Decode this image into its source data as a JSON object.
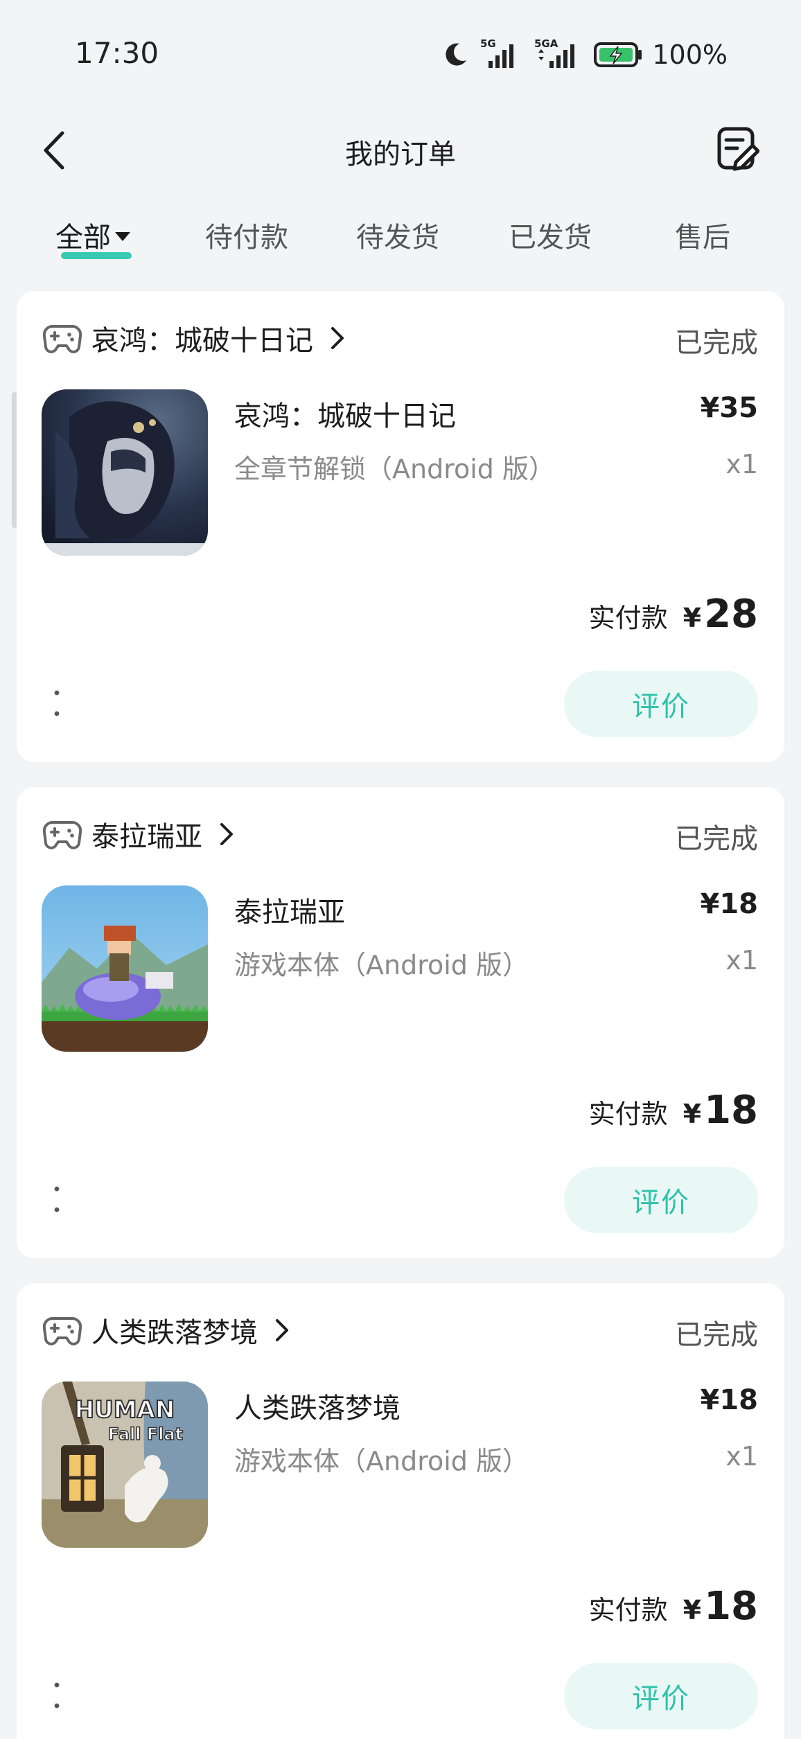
{
  "status_bar": {
    "time": "17:30",
    "battery_percent": "100%",
    "signal_1": "5G",
    "signal_2": "5GA",
    "icons": [
      "moon-icon",
      "signal-5g-icon",
      "signal-5ga-icon",
      "battery-charging-icon"
    ]
  },
  "nav": {
    "title": "我的订单",
    "back_icon": "back-chevron-icon",
    "edit_icon": "order-edit-icon"
  },
  "tabs": [
    {
      "label": "全部",
      "active": true
    },
    {
      "label": "待付款",
      "active": false
    },
    {
      "label": "待发货",
      "active": false
    },
    {
      "label": "已发货",
      "active": false
    },
    {
      "label": "售后",
      "active": false
    }
  ],
  "accent_color": "#37c9b3",
  "orders": [
    {
      "store": "哀鸿：城破十日记",
      "status": "已完成",
      "product_title": "哀鸿：城破十日记",
      "price": "¥35",
      "sku": "全章节解锁（Android 版）",
      "qty": "x1",
      "paid_label": "实付款",
      "paid_currency": "¥",
      "paid_amount": "28",
      "review_label": "评价"
    },
    {
      "store": "泰拉瑞亚",
      "status": "已完成",
      "product_title": "泰拉瑞亚",
      "price": "¥18",
      "sku": "游戏本体（Android 版）",
      "qty": "x1",
      "paid_label": "实付款",
      "paid_currency": "¥",
      "paid_amount": "18",
      "review_label": "评价"
    },
    {
      "store": "人类跌落梦境",
      "status": "已完成",
      "product_title": "人类跌落梦境",
      "price": "¥18",
      "sku": "游戏本体（Android 版）",
      "qty": "x1",
      "paid_label": "实付款",
      "paid_currency": "¥",
      "paid_amount": "18",
      "review_label": "评价",
      "thumb_logo_line1": "HUMAN",
      "thumb_logo_line2": "Fall Flat"
    }
  ]
}
